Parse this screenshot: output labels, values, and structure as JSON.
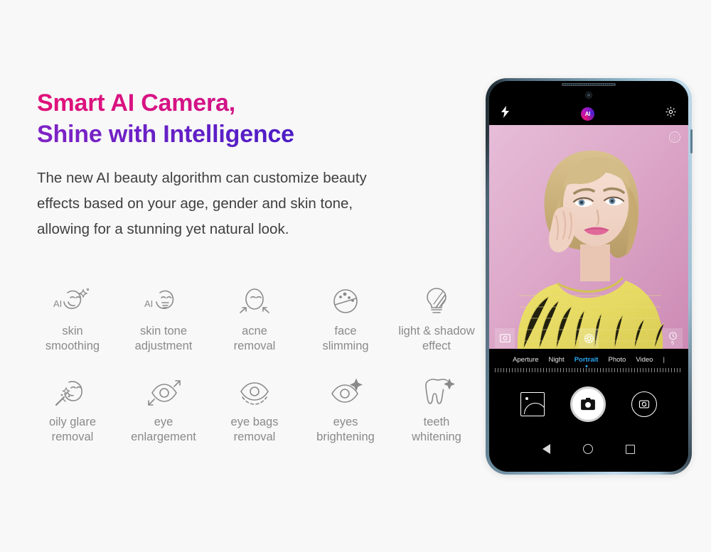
{
  "background_color": "#f8f8f8",
  "headline": {
    "line1": "Smart AI Camera,",
    "line2": "Shine with Intelligence",
    "line1_gradient_from": "#e0117a",
    "line1_gradient_to": "#c0159a",
    "line2_gradient_from": "#8122c6",
    "line2_gradient_to": "#2717c4"
  },
  "body_text": "The new AI beauty algorithm can customize beauty effects based on your age, gender and skin tone, allowing for a stunning yet natural look.",
  "features": [
    {
      "icon": "ai-face-sparkle-icon",
      "label": "skin\nsmoothing"
    },
    {
      "icon": "ai-face-tone-icon",
      "label": "skin tone\nadjustment"
    },
    {
      "icon": "face-acne-arrows-icon",
      "label": "acne\nremoval"
    },
    {
      "icon": "face-slimming-circle-icon",
      "label": "face\nslimming"
    },
    {
      "icon": "lightbulb-shadow-icon",
      "label": "light & shadow\neffect"
    },
    {
      "icon": "face-oil-wand-icon",
      "label": "oily glare\nremoval"
    },
    {
      "icon": "eye-enlarge-arrows-icon",
      "label": "eye\nenlargement"
    },
    {
      "icon": "eye-bags-dashed-icon",
      "label": "eye bags\nremoval"
    },
    {
      "icon": "eye-sparkle-icon",
      "label": "eyes\nbrightening"
    },
    {
      "icon": "tooth-sparkle-icon",
      "label": "teeth\nwhitening"
    }
  ],
  "phone": {
    "frame_color": "#8fb4c9",
    "topbar": {
      "flash_icon": "flash-icon",
      "ai_badge_label": "AI",
      "settings_icon": "gear-icon"
    },
    "viewfinder": {
      "corner_icon": "info-circle-icon",
      "overlay_buttons": [
        {
          "icon": "portrait-frame-icon",
          "value": ""
        },
        {
          "icon": "beauty-aperture-icon",
          "value": ""
        },
        {
          "icon": "timer-icon",
          "value": "5"
        }
      ]
    },
    "modes": [
      {
        "label": "Aperture",
        "active": false
      },
      {
        "label": "Night",
        "active": false
      },
      {
        "label": "Portrait",
        "active": true
      },
      {
        "label": "Photo",
        "active": false
      },
      {
        "label": "Video",
        "active": false
      },
      {
        "label": "|",
        "active": false
      }
    ],
    "active_mode_color": "#2aa8f2",
    "controls": {
      "gallery_icon": "gallery-thumbnail-icon",
      "shutter_icon": "camera-shutter-icon",
      "flip_icon": "camera-flip-icon"
    },
    "navbar": {
      "back_icon": "nav-back-icon",
      "home_icon": "nav-home-icon",
      "recents_icon": "nav-recents-icon"
    }
  }
}
